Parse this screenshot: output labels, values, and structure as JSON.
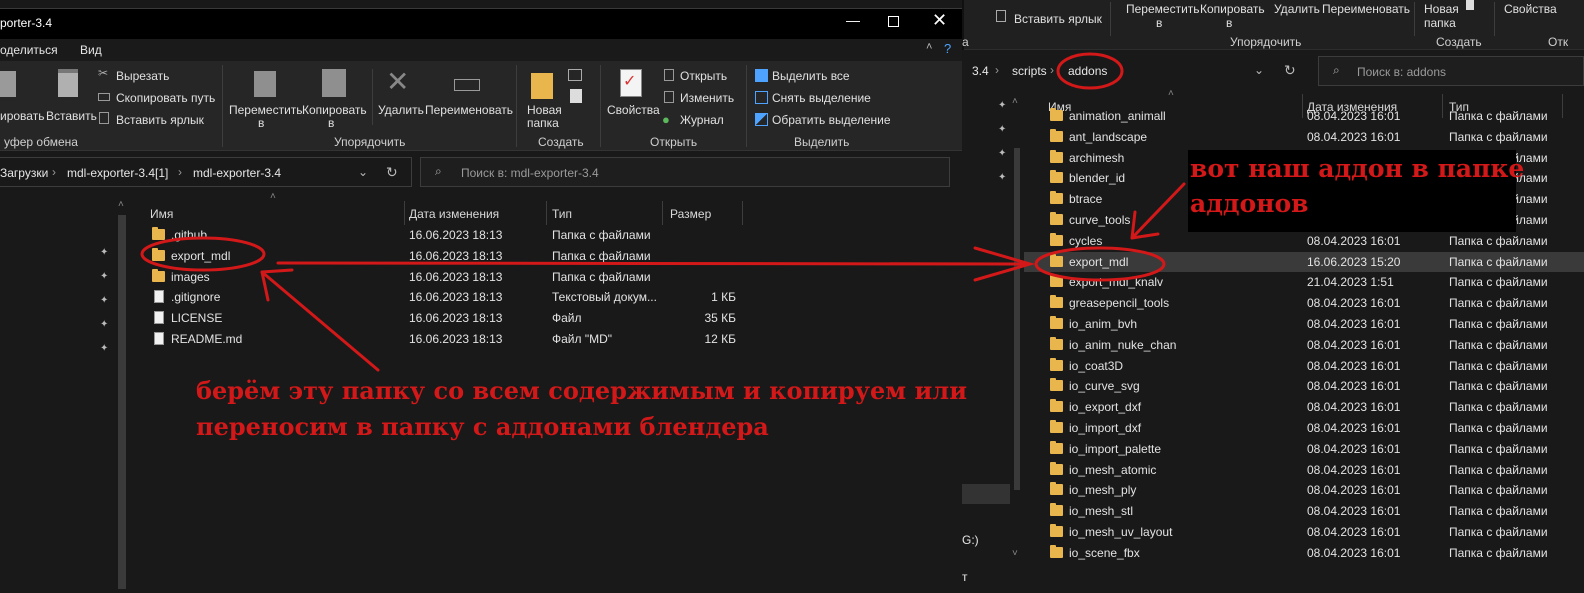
{
  "right_window": {
    "ribbon_top": {
      "paste_shortcut_label": "Вставить ярлык",
      "move_label": "Переместить",
      "move_sub": "в",
      "copy_label": "Копировать",
      "copy_sub": "в",
      "delete_label": "Удалить",
      "rename_label": "Переименовать",
      "new_folder_label": "Новая",
      "new_folder_label2": "папка",
      "properties_label": "Свойства",
      "group_paste_cut": "а",
      "group_organize": "Упорядочить",
      "group_create": "Создать",
      "group_open_cut": "Отк"
    },
    "breadcrumb": [
      "3.4",
      "scripts",
      "addons"
    ],
    "search_placeholder": "Поиск в: addons",
    "columns": [
      "Имя",
      "Дата изменения",
      "Тип"
    ],
    "rows": [
      {
        "name": "animation_animall",
        "date": "08.04.2023 16:01",
        "type": "Папка с файлами"
      },
      {
        "name": "ant_landscape",
        "date": "08.04.2023 16:01",
        "type": "Папка с файлами"
      },
      {
        "name": "archimesh",
        "date": "",
        "type": "Папка с файлами"
      },
      {
        "name": "blender_id",
        "date": "",
        "type": "Папка с файлами"
      },
      {
        "name": "btrace",
        "date": "",
        "type": "Папка с файлами"
      },
      {
        "name": "curve_tools",
        "date": "",
        "type": "Папка с файлами"
      },
      {
        "name": "cycles",
        "date": "08.04.2023 16:01",
        "type": "Папка с файлами"
      },
      {
        "name": "export_mdl",
        "date": "16.06.2023 15:20",
        "type": "Папка с файлами"
      },
      {
        "name": "export_mdl_knalv",
        "date": "21.04.2023 1:51",
        "type": "Папка с файлами"
      },
      {
        "name": "greasepencil_tools",
        "date": "08.04.2023 16:01",
        "type": "Папка с файлами"
      },
      {
        "name": "io_anim_bvh",
        "date": "08.04.2023 16:01",
        "type": "Папка с файлами"
      },
      {
        "name": "io_anim_nuke_chan",
        "date": "08.04.2023 16:01",
        "type": "Папка с файлами"
      },
      {
        "name": "io_coat3D",
        "date": "08.04.2023 16:01",
        "type": "Папка с файлами"
      },
      {
        "name": "io_curve_svg",
        "date": "08.04.2023 16:01",
        "type": "Папка с файлами"
      },
      {
        "name": "io_export_dxf",
        "date": "08.04.2023 16:01",
        "type": "Папка с файлами"
      },
      {
        "name": "io_import_dxf",
        "date": "08.04.2023 16:01",
        "type": "Папка с файлами"
      },
      {
        "name": "io_import_palette",
        "date": "08.04.2023 16:01",
        "type": "Папка с файлами"
      },
      {
        "name": "io_mesh_atomic",
        "date": "08.04.2023 16:01",
        "type": "Папка с файлами"
      },
      {
        "name": "io_mesh_ply",
        "date": "08.04.2023 16:01",
        "type": "Папка с файлами"
      },
      {
        "name": "io_mesh_stl",
        "date": "08.04.2023 16:01",
        "type": "Папка с файлами"
      },
      {
        "name": "io_mesh_uv_layout",
        "date": "08.04.2023 16:01",
        "type": "Папка с файлами"
      },
      {
        "name": "io_scene_fbx",
        "date": "08.04.2023 16:01",
        "type": "Папка с файлами"
      }
    ],
    "nav_partial_g": "G:)",
    "status_partial": "т"
  },
  "left_window": {
    "title": "porter-3.4",
    "menu": [
      "оделиться",
      "Вид"
    ],
    "ribbon": {
      "copy_path_partial": "ировать",
      "paste_label": "Вставить",
      "cut_label": "Вырезать",
      "copy_path_label": "Скопировать путь",
      "paste_shortcut_label": "Вставить ярлык",
      "move_label": "Переместить",
      "move_sub": "в",
      "copy_label": "Копировать",
      "copy_sub": "в",
      "delete_label": "Удалить",
      "rename_label": "Переименовать",
      "new_folder_label": "Новая",
      "new_folder_label2": "папка",
      "properties_label": "Свойства",
      "open_label": "Открыть",
      "edit_label": "Изменить",
      "history_label": "Журнал",
      "select_all_label": "Выделить все",
      "select_none_label": "Снять выделение",
      "invert_selection_label": "Обратить выделение",
      "group_clipboard": "уфер обмена",
      "group_organize": "Упорядочить",
      "group_create": "Создать",
      "group_open": "Открыть",
      "group_select": "Выделить"
    },
    "breadcrumb": [
      "Загрузки",
      "mdl-exporter-3.4[1]",
      "mdl-exporter-3.4"
    ],
    "search_placeholder": "Поиск в: mdl-exporter-3.4",
    "columns": [
      "Имя",
      "Дата изменения",
      "Тип",
      "Размер"
    ],
    "rows": [
      {
        "name": ".github",
        "date": "16.06.2023 18:13",
        "type": "Папка с файлами",
        "size": "",
        "icon": "folder"
      },
      {
        "name": "export_mdl",
        "date": "16.06.2023 18:13",
        "type": "Папка с файлами",
        "size": "",
        "icon": "folder"
      },
      {
        "name": "images",
        "date": "16.06.2023 18:13",
        "type": "Папка с файлами",
        "size": "",
        "icon": "folder"
      },
      {
        "name": ".gitignore",
        "date": "16.06.2023 18:13",
        "type": "Текстовый докум...",
        "size": "1 КБ",
        "icon": "file"
      },
      {
        "name": "LICENSE",
        "date": "16.06.2023 18:13",
        "type": "Файл",
        "size": "35 КБ",
        "icon": "file"
      },
      {
        "name": "README.md",
        "date": "16.06.2023 18:13",
        "type": "Файл \"MD\"",
        "size": "12 КБ",
        "icon": "file"
      }
    ]
  },
  "annotations": {
    "left_line1": "берём эту папку со всем содержимым и копируем или",
    "left_line2": "переносим в папку с аддонами блендера",
    "right_line1": "вот наш аддон в папке",
    "right_line2": "аддонов",
    "color": "#d21818"
  }
}
